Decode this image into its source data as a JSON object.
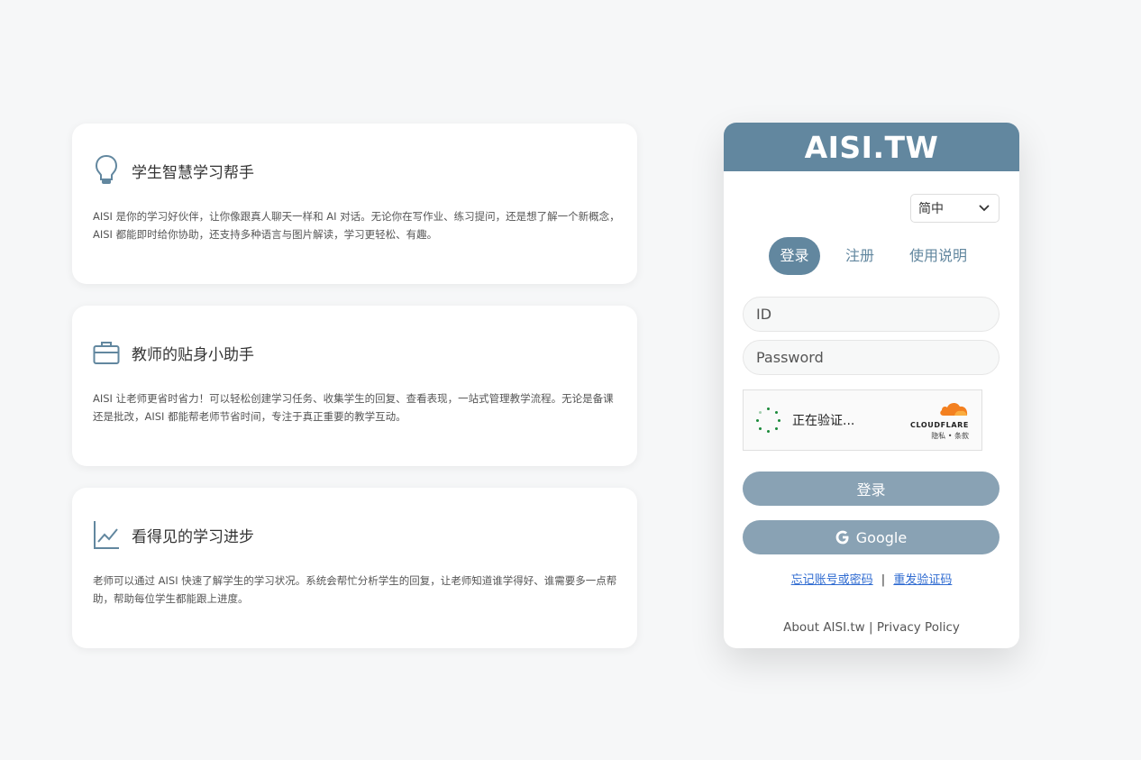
{
  "features": [
    {
      "title": "学生智慧学习帮手",
      "icon": "lightbulb-icon",
      "description": "AISI 是你的学习好伙伴，让你像跟真人聊天一样和 AI 对话。无论你在写作业、练习提问，还是想了解一个新概念，AISI 都能即时给你协助，还支持多种语言与图片解读，学习更轻松、有趣。"
    },
    {
      "title": "教师的贴身小助手",
      "icon": "briefcase-icon",
      "description": "AISI 让老师更省时省力！可以轻松创建学习任务、收集学生的回复、查看表现，一站式管理教学流程。无论是备课还是批改，AISI 都能帮老师节省时间，专注于真正重要的教学互动。"
    },
    {
      "title": "看得见的学习进步",
      "icon": "line-chart-icon",
      "description": "老师可以通过 AISI 快速了解学生的学习状况。系统会帮忙分析学生的回复，让老师知道谁学得好、谁需要多一点帮助，帮助每位学生都能跟上进度。"
    }
  ],
  "login": {
    "brand": "AISI.TW",
    "language": "简中",
    "tabs": [
      "登录",
      "注册",
      "使用说明"
    ],
    "id_placeholder": "ID",
    "password_placeholder": "Password",
    "captcha_status": "正在验证...",
    "captcha_provider": "CLOUDFLARE",
    "captcha_links": "隐私 • 条款",
    "submit_label": "登录",
    "google_label": "Google",
    "forgot_link": "忘记账号或密码",
    "separator": "|",
    "resend_link": "重发验证码",
    "footer_about": "About AISI.tw",
    "footer_sep": "|",
    "footer_privacy": "Privacy Policy"
  },
  "colors": {
    "accent": "#62879f",
    "button": "#89a2b4",
    "link": "#2f6bd1",
    "cloudflare": "#f38020"
  }
}
